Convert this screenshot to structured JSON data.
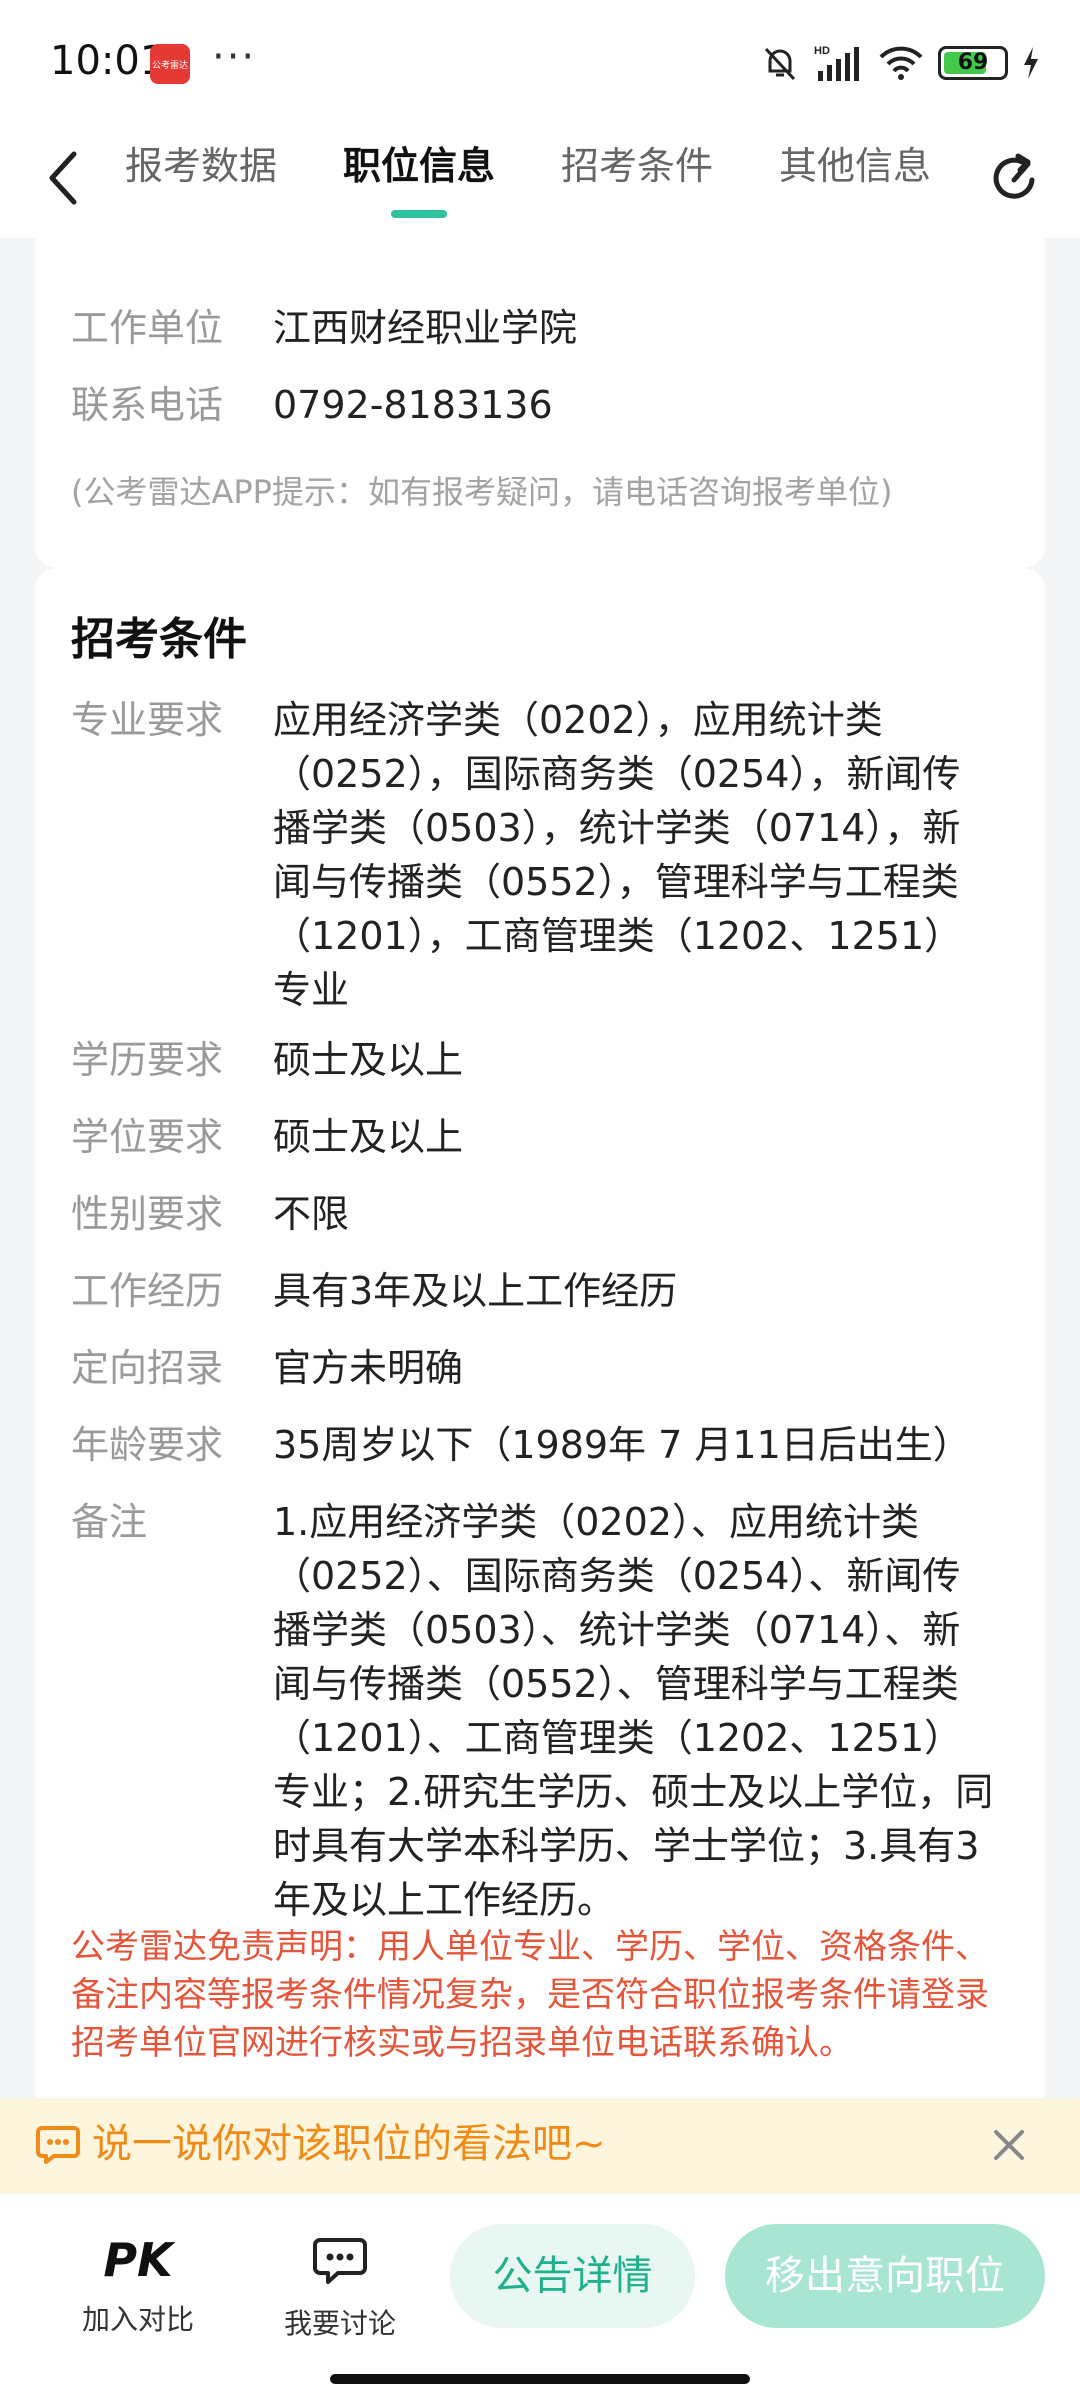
{
  "status_bar": {
    "time": "10:01",
    "app_badge": "公考雷达",
    "more": "···",
    "battery": "69"
  },
  "nav": {
    "tabs": [
      {
        "label": "报考数据"
      },
      {
        "label": "职位信息"
      },
      {
        "label": "招考条件"
      },
      {
        "label": "其他信息"
      }
    ],
    "active_tab": "职位信息"
  },
  "unit_card": {
    "rows": [
      {
        "label": "工作单位",
        "value": "江西财经职业学院"
      },
      {
        "label": "联系电话",
        "value": "0792-8183136"
      }
    ],
    "hint": "(公考雷达APP提示：如有报考疑问，请电话咨询报考单位)"
  },
  "conditions_card": {
    "title": "招考条件",
    "rows": [
      {
        "label": "专业要求",
        "value": "应用经济学类（0202），应用统计类（0252），国际商务类（0254），新闻传播学类（0503），统计学类（0714），新闻与传播类（0552），管理科学与工程类（1201），工商管理类（1202、1251）专业"
      },
      {
        "label": "学历要求",
        "value": "硕士及以上"
      },
      {
        "label": "学位要求",
        "value": "硕士及以上"
      },
      {
        "label": "性别要求",
        "value": "不限"
      },
      {
        "label": "工作经历",
        "value": "具有3年及以上工作经历"
      },
      {
        "label": "定向招录",
        "value": "官方未明确"
      },
      {
        "label": "年龄要求",
        "value": "35周岁以下（1989年 7 月11日后出生）"
      },
      {
        "label": "备注",
        "value": "1.应用经济学类（0202）、应用统计类（0252）、国际商务类（0254）、新闻传播学类（0503）、统计学类（0714）、新闻与传播类（0552）、管理科学与工程类（1201）、工商管理类（1202、1251）专业；2.研究生学历、硕士及以上学位，同时具有大学本科学历、学士学位；3.具有3年及以上工作经历。"
      }
    ],
    "disclaimer": "公考雷达免责声明：用人单位专业、学历、学位、资格条件、备注内容等报考条件情况复杂，是否符合职位报考条件请登录招考单位官网进行核实或与招录单位电话联系确认。"
  },
  "comment_bar": {
    "text": "说一说你对该职位的看法吧~"
  },
  "bottom_bar": {
    "pk_logo": "PK",
    "compare_label": "加入对比",
    "discuss_label": "我要讨论",
    "notice_button": "公告详情",
    "remove_button": "移出意向职位"
  },
  "colors": {
    "accent": "#2ec39e",
    "warning_text": "#e5553a",
    "comment_text": "#f18b18",
    "comment_bg": "#fdf5dd"
  }
}
